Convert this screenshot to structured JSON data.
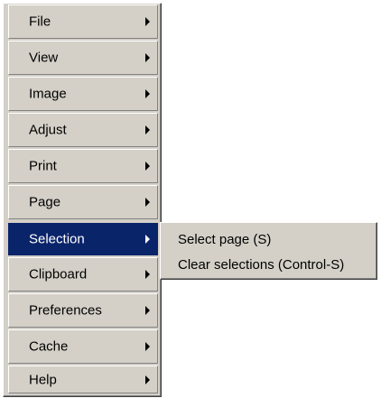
{
  "menu": {
    "items": [
      {
        "label": "File",
        "has_submenu": true
      },
      {
        "label": "View",
        "has_submenu": true
      },
      {
        "label": "Image",
        "has_submenu": true
      },
      {
        "label": "Adjust",
        "has_submenu": true
      },
      {
        "label": "Print",
        "has_submenu": true
      },
      {
        "label": "Page",
        "has_submenu": true
      },
      {
        "label": "Selection",
        "has_submenu": true
      },
      {
        "label": "Clipboard",
        "has_submenu": true
      },
      {
        "label": "Preferences",
        "has_submenu": true
      },
      {
        "label": "Cache",
        "has_submenu": true
      },
      {
        "label": "Help",
        "has_submenu": true
      }
    ],
    "active_item": "Selection"
  },
  "submenu": {
    "parent": "Selection",
    "items": [
      {
        "label": "Select page (S)"
      },
      {
        "label": "Clear selections (Control-S)"
      }
    ]
  },
  "colors": {
    "menu_face": "#d4d0c8",
    "highlight": "#0a246a",
    "highlight_text": "#ffffff",
    "text": "#000000"
  },
  "icons": {
    "submenu_arrow": "triangle-right-icon"
  }
}
